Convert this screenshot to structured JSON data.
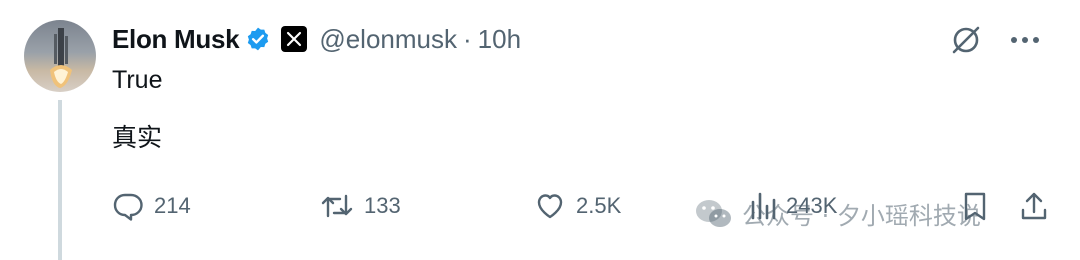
{
  "tweet": {
    "author_name": "Elon Musk",
    "handle": "@elonmusk",
    "separator": "·",
    "time": "10h",
    "text_lines": [
      "True",
      "真实"
    ]
  },
  "actions": {
    "replies": "214",
    "reposts": "133",
    "likes": "2.5K",
    "views": "243K"
  },
  "watermark": "公众号 · 夕小瑶科技说",
  "colors": {
    "verified": "#1d9bf0",
    "muted": "#536471",
    "thread_line": "#cfd9de"
  }
}
